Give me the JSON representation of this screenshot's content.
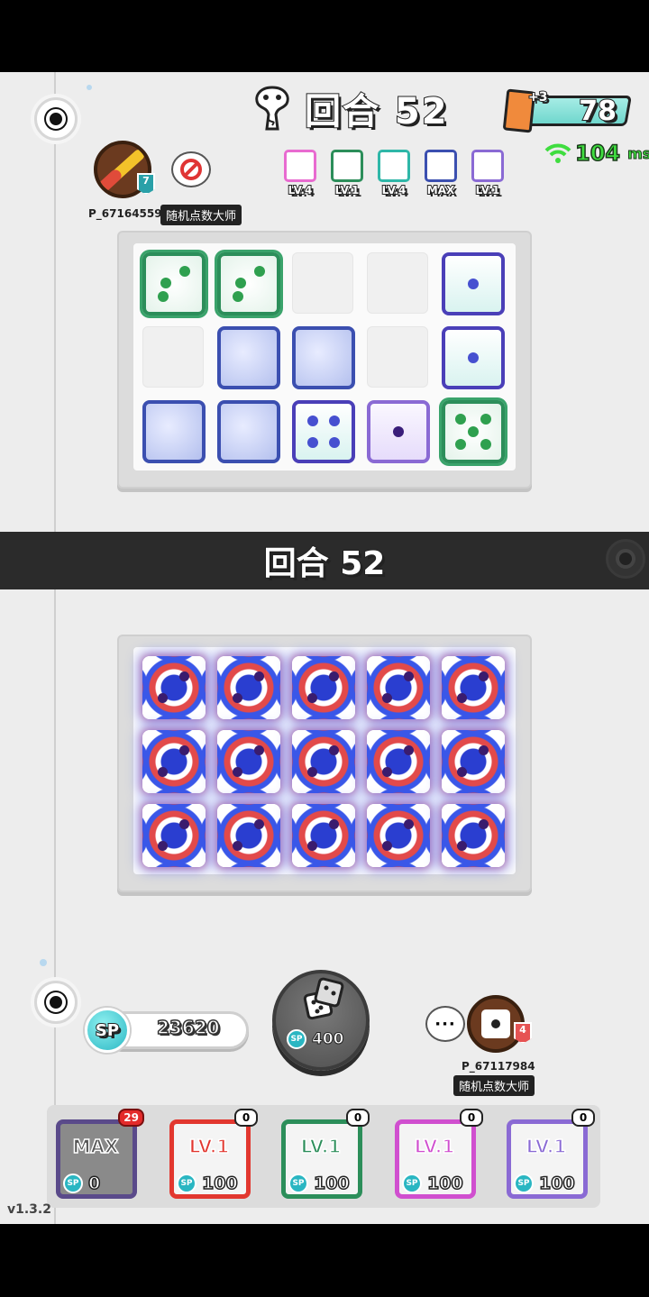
{
  "header": {
    "round_label": "回合 52",
    "cards": {
      "bonus": "+3",
      "count": "78"
    },
    "ping": {
      "value": "104",
      "unit": "ms"
    }
  },
  "opponent": {
    "name": "P_67164559",
    "title": "随机点数大师",
    "level": "7",
    "deck": [
      {
        "type": "rainbow",
        "level": "LV.4",
        "color": "#e86bd0"
      },
      {
        "type": "pentagram",
        "level": "LV.1",
        "color": "#2c8e5a"
      },
      {
        "type": "hand",
        "level": "LV.4",
        "color": "#2fb7a8"
      },
      {
        "type": "gear",
        "level": "MAX",
        "color": "#3b4fb0"
      },
      {
        "type": "crack",
        "level": "LV.1",
        "color": "#8a6ad4"
      }
    ],
    "board": [
      [
        "penta:3",
        "penta:3",
        "",
        "",
        "hand:1"
      ],
      [
        "",
        "gear:0",
        "gear:0",
        "",
        "hand:1"
      ],
      [
        "gear:0",
        "gear:0",
        "hand:4",
        "crack:1",
        "penta:5"
      ]
    ]
  },
  "divider": {
    "round_label": "回合 52"
  },
  "player": {
    "name": "P_67117984",
    "title": "随机点数大师",
    "level": "4",
    "sp": {
      "label": "SP",
      "amount": "23620"
    },
    "roll": {
      "cost": "400",
      "sp_label": "SP"
    },
    "board": [
      [
        "storm:2",
        "storm:2",
        "storm:2",
        "storm:2",
        "storm:2"
      ],
      [
        "storm:2",
        "storm:2",
        "storm:2",
        "storm:2",
        "storm:2"
      ],
      [
        "storm:2",
        "storm:2",
        "storm:2",
        "storm:2",
        "storm:2"
      ]
    ],
    "deck_upgrades": [
      {
        "level": "MAX",
        "cost": "0",
        "count": "29",
        "color": "#5a4a8a"
      },
      {
        "level": "LV.1",
        "cost": "100",
        "count": "0",
        "color": "#e2372f"
      },
      {
        "level": "LV.1",
        "cost": "100",
        "count": "0",
        "color": "#2c8e5a"
      },
      {
        "level": "LV.1",
        "cost": "100",
        "count": "0",
        "color": "#d04fcf"
      },
      {
        "level": "LV.1",
        "cost": "100",
        "count": "0",
        "color": "#8a6ad4"
      }
    ]
  },
  "version": "v1.3.2"
}
